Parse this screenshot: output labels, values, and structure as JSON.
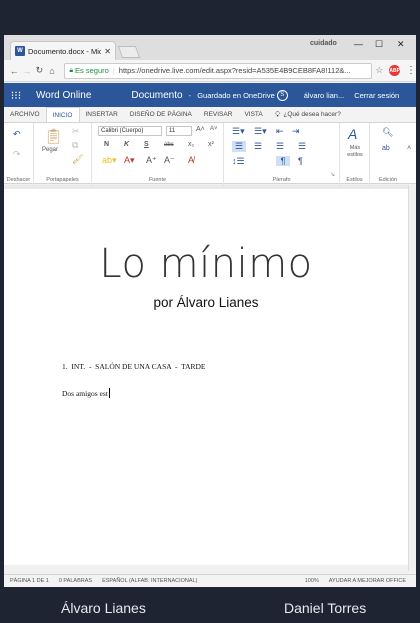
{
  "browser": {
    "tab_title": "Documento.docx - Micr",
    "profile_label": "cuidado",
    "secure_label": "Es seguro",
    "url": "https://onedrive.live.com/edit.aspx?resid=A535E4B9CEB8FA8!112&..."
  },
  "word": {
    "app_name": "Word Online",
    "doc_name": "Documento",
    "saved_status": "Guardado en OneDrive",
    "user_name": "álvaro lian...",
    "sign_out": "Cerrar sesión"
  },
  "ribbon": {
    "tabs": [
      "ARCHIVO",
      "INICIO",
      "INSERTAR",
      "DISEÑO DE PÁGINA",
      "REVISAR",
      "VISTA"
    ],
    "tell_me": "¿Qué desea hacer?",
    "font_name": "Calibri (Cuerpo)",
    "font_size": "11",
    "paste_label": "Pegar",
    "styles_label": "Más estilos",
    "groups": {
      "undo": "Deshacer",
      "clipboard": "Portapapeles",
      "font": "Fuente",
      "paragraph": "Párrafo",
      "styles": "Estilos",
      "editing": "Edición"
    },
    "bold_glyph": "N",
    "italic_glyph": "K",
    "underline_glyph": "S",
    "strike_glyph": "abc",
    "sub_glyph": "x₂",
    "sup_glyph": "x²"
  },
  "document": {
    "title": "Lo mínimo",
    "byline": "por Álvaro Lianes",
    "scene_heading": "1.  INT.  -  SALÓN DE UNA CASA  -  TARDE",
    "paragraph": "Dos amigos est"
  },
  "status": {
    "page": "PÁGINA 1 DE 1",
    "words": "0 PALABRAS",
    "language": "ESPAÑOL (ALFAB. INTERNACIONAL)",
    "zoom": "100%",
    "help": "AYUDAR A MEJORAR OFFICE"
  },
  "credits": {
    "left": "Álvaro Lianes",
    "right": "Daniel Torres"
  },
  "colors": {
    "word_blue": "#2b579a",
    "background": "#1f2433"
  }
}
